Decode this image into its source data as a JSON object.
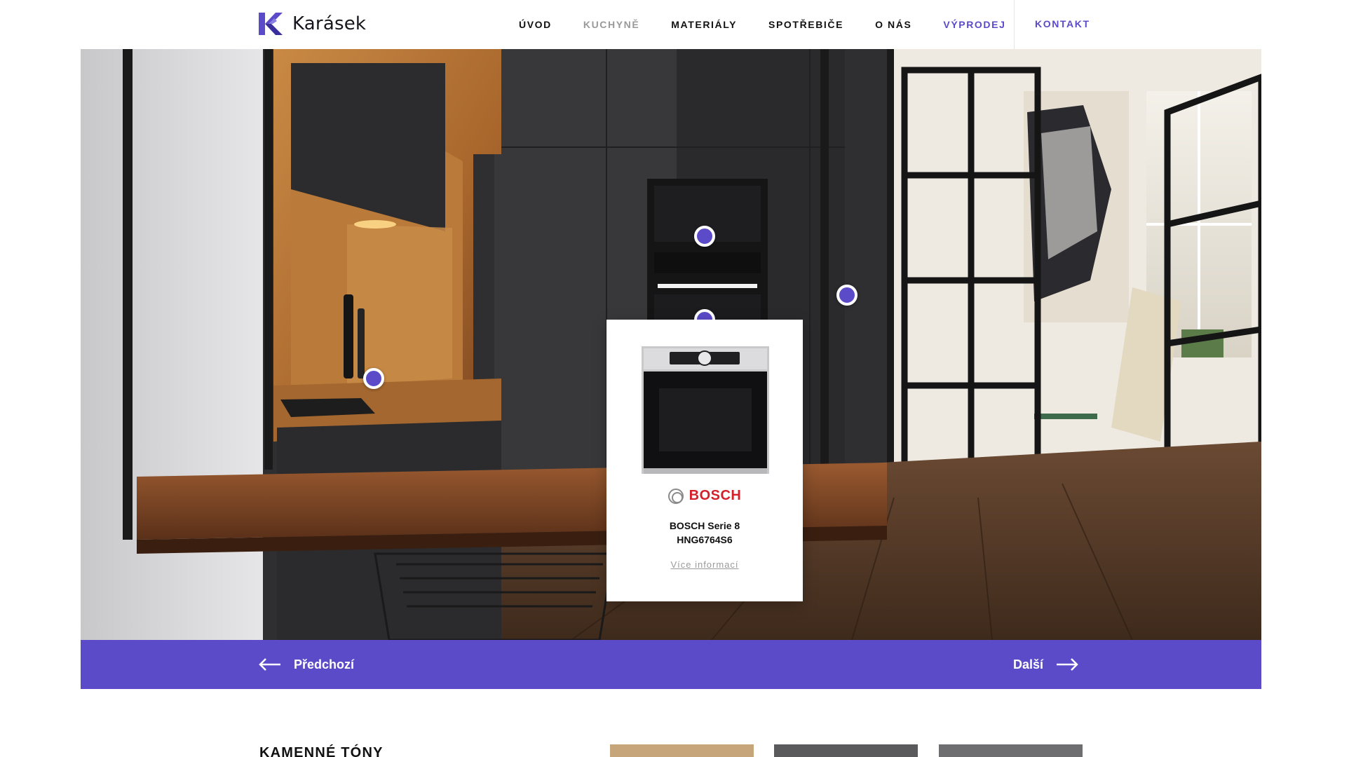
{
  "brand": {
    "name": "Karásek",
    "accent": "#5b4bc9"
  },
  "nav": {
    "items": [
      {
        "label": "ÚVOD"
      },
      {
        "label": "KUCHYNĚ"
      },
      {
        "label": "MATERIÁLY"
      },
      {
        "label": "SPOTŘEBIČE"
      },
      {
        "label": "O NÁS"
      },
      {
        "label": "VÝPRODEJ"
      }
    ],
    "contact": "KONTAKT"
  },
  "hotspots": [
    "hotspot",
    "hotspot",
    "hotspot",
    "hotspot"
  ],
  "product_card": {
    "brand": "BOSCH",
    "title_line1": "BOSCH Serie 8",
    "title_line2": "HNG6764S6",
    "link": "Více informací"
  },
  "slider": {
    "prev_label": "Předchozí",
    "next_label": "Další"
  },
  "section": {
    "title": "KAMENNÉ TÓNY"
  },
  "swatches": [
    {
      "name": "oak",
      "color": "#c7a57a"
    },
    {
      "name": "dark-grey",
      "color": "#5a5a5c"
    },
    {
      "name": "grey",
      "color": "#6e6e70"
    }
  ]
}
